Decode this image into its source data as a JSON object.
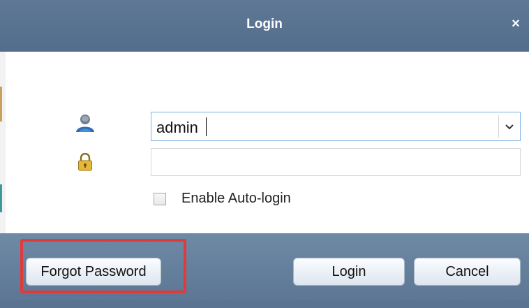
{
  "dialog": {
    "title": "Login",
    "close_label": "×"
  },
  "form": {
    "username_value": "admin",
    "password_value": "",
    "auto_login_label": "Enable Auto-login",
    "auto_login_checked": false
  },
  "buttons": {
    "forgot_password": "Forgot Password",
    "login": "Login",
    "cancel": "Cancel"
  },
  "icons": {
    "user": "user-icon",
    "lock": "lock-icon",
    "dropdown": "chevron-down-icon",
    "close": "close-icon"
  },
  "colors": {
    "titlebar": "#5a7391",
    "footer": "#6a85a1",
    "highlight": "#e23a3a",
    "input_focus_border": "#7fb2e5"
  }
}
